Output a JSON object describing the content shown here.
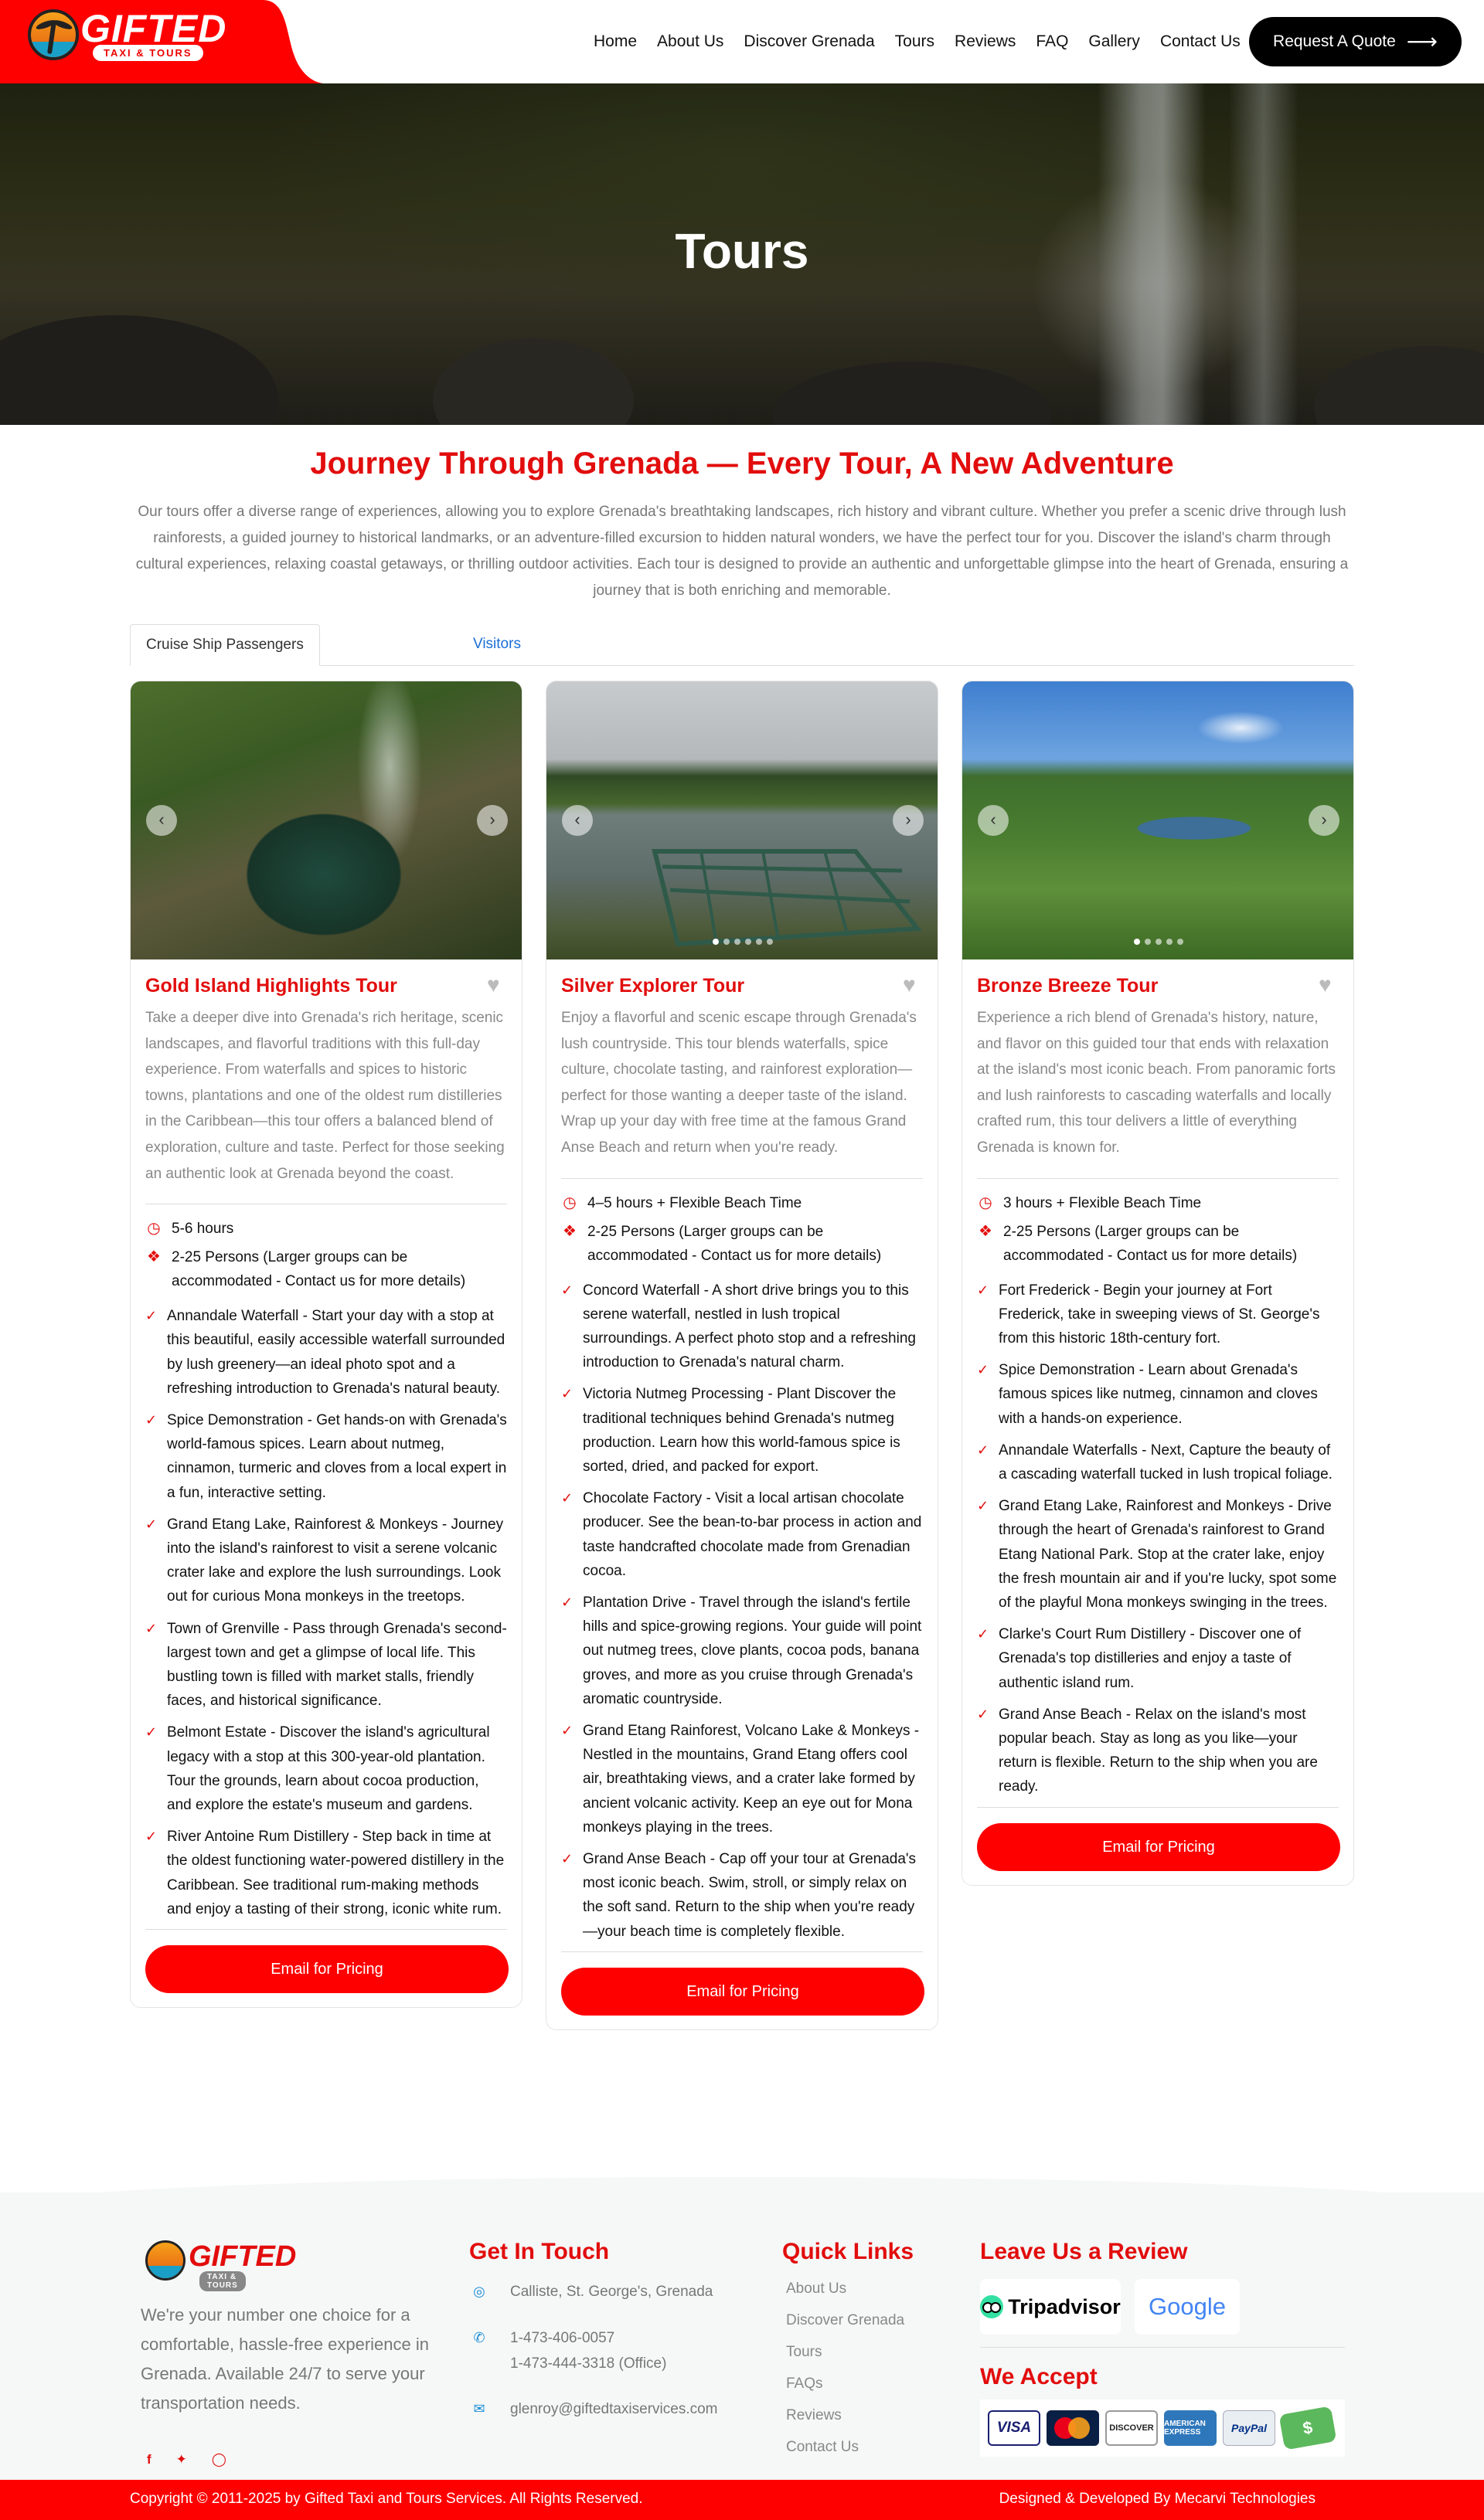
{
  "brand": {
    "name": "GIFTED",
    "tagline": "TAXI & TOURS"
  },
  "nav": [
    {
      "label": "Home"
    },
    {
      "label": "About Us"
    },
    {
      "label": "Discover Grenada"
    },
    {
      "label": "Tours"
    },
    {
      "label": "Reviews"
    },
    {
      "label": "FAQ"
    },
    {
      "label": "Gallery"
    },
    {
      "label": "Contact Us"
    }
  ],
  "cta": {
    "label": "Request A Quote",
    "icon": "arrow-right-icon"
  },
  "hero": {
    "title": "Tours"
  },
  "intro": {
    "title": "Journey Through Grenada — Every Tour, A New Adventure",
    "text": "Our tours offer a diverse range of experiences, allowing you to explore Grenada's breathtaking landscapes, rich history and vibrant culture. Whether you prefer a scenic drive through lush rainforests, a guided journey to historical landmarks, or an adventure-filled excursion to hidden natural wonders, we have the perfect tour for you. Discover the island's charm through cultural experiences, relaxing coastal getaways, or thrilling outdoor activities. Each tour is designed to provide an authentic and unforgettable glimpse into the heart of Grenada, ensuring a journey that is both enriching and memorable."
  },
  "tabs": [
    {
      "label": "Cruise Ship Passengers",
      "active": true
    },
    {
      "label": "Visitors",
      "active": false
    }
  ],
  "tours": [
    {
      "title": "Gold Island Highlights Tour",
      "description": "Take a deeper dive into Grenada's rich heritage, scenic landscapes, and flavorful traditions with this full-day experience. From waterfalls and spices to historic towns, plantations and one of the oldest rum distilleries in the Caribbean—this tour offers a balanced blend of exploration, culture and taste. Perfect for those seeking an authentic look at Grenada beyond the coast.",
      "duration": "5-6 hours",
      "group": "2-25 Persons (Larger groups can be accommodated - Contact us for more details)",
      "items": [
        "Annandale Waterfall - Start your day with a stop at this beautiful, easily accessible waterfall surrounded by lush greenery—an ideal photo spot and a refreshing introduction to Grenada's natural beauty.",
        "Spice Demonstration - Get hands-on with Grenada's world-famous spices. Learn about nutmeg, cinnamon, turmeric and cloves from a local expert in a fun, interactive setting.",
        "Grand Etang Lake, Rainforest & Monkeys - Journey into the island's rainforest to visit a serene volcanic crater lake and explore the lush surroundings. Look out for curious Mona monkeys in the treetops.",
        "Town of Grenville - Pass through Grenada's second-largest town and get a glimpse of local life. This bustling town is filled with market stalls, friendly faces, and historical significance.",
        "Belmont Estate - Discover the island's agricultural legacy with a stop at this 300-year-old plantation. Tour the grounds, learn about cocoa production, and explore the estate's museum and gardens.",
        "River Antoine Rum Distillery - Step back in time at the oldest functioning water-powered distillery in the Caribbean. See traditional rum-making methods and enjoy a tasting of their strong, iconic white rum."
      ],
      "button": "Email for Pricing"
    },
    {
      "title": "Silver Explorer Tour",
      "description": "Enjoy a flavorful and scenic escape through Grenada's lush countryside. This tour blends waterfalls, spice culture, chocolate tasting, and rainforest exploration—perfect for those wanting a deeper taste of the island. Wrap up your day with free time at the famous Grand Anse Beach and return when you're ready.",
      "duration": "4–5 hours + Flexible Beach Time",
      "group": "2-25 Persons (Larger groups can be accommodated - Contact us for more details)",
      "items": [
        "Concord Waterfall - A short drive brings you to this serene waterfall, nestled in lush tropical surroundings. A perfect photo stop and a refreshing introduction to Grenada's natural charm.",
        "Victoria Nutmeg Processing - Plant Discover the traditional techniques behind Grenada's nutmeg production. Learn how this world-famous spice is sorted, dried, and packed for export.",
        "Chocolate Factory - Visit a local artisan chocolate producer. See the bean-to-bar process in action and taste handcrafted chocolate made from Grenadian cocoa.",
        "Plantation Drive - Travel through the island's fertile hills and spice-growing regions. Your guide will point out nutmeg trees, clove plants, cocoa pods, banana groves, and more as you cruise through Grenada's aromatic countryside.",
        "Grand Etang Rainforest, Volcano Lake & Monkeys - Nestled in the mountains, Grand Etang offers cool air, breathtaking views, and a crater lake formed by ancient volcanic activity. Keep an eye out for Mona monkeys playing in the trees.",
        "Grand Anse Beach - Cap off your tour at Grenada's most iconic beach. Swim, stroll, or simply relax on the soft sand. Return to the ship when you're ready—your beach time is completely flexible."
      ],
      "button": "Email for Pricing"
    },
    {
      "title": "Bronze Breeze Tour",
      "description": "Experience a rich blend of Grenada's history, nature, and flavor on this guided tour that ends with relaxation at the island's most iconic beach. From panoramic forts and lush rainforests to cascading waterfalls and locally crafted rum, this tour delivers a little of everything Grenada is known for.",
      "duration": "3 hours + Flexible Beach Time",
      "group": "2-25 Persons (Larger groups can be accommodated - Contact us for more details)",
      "items": [
        "Fort Frederick - Begin your journey at Fort Frederick, take in sweeping views of St. George's from this historic 18th-century fort.",
        "Spice Demonstration - Learn about Grenada's famous spices like nutmeg, cinnamon and cloves with a hands-on experience.",
        "Annandale Waterfalls - Next, Capture the beauty of a cascading waterfall tucked in lush tropical foliage.",
        "Grand Etang Lake, Rainforest and Monkeys - Drive through the heart of Grenada's rainforest to Grand Etang National Park. Stop at the crater lake, enjoy the fresh mountain air and if you're lucky, spot some of the playful Mona monkeys swinging in the trees.",
        "Clarke's Court Rum Distillery - Discover one of Grenada's top distilleries and enjoy a taste of authentic island rum.",
        "Grand Anse Beach - Relax on the island's most popular beach. Stay as long as you like—your return is flexible. Return to the ship when you are ready."
      ],
      "button": "Email for Pricing"
    }
  ],
  "footer": {
    "about": "We're your number one choice for a comfortable, hassle-free experience in Grenada. Available 24/7 to serve your transportation needs.",
    "contact_title": "Get In Touch",
    "address": "Calliste, St. George's, Grenada",
    "phone1": "1-473-406-0057",
    "phone2": "1-473-444-3318 (Office)",
    "email": "glenroy@giftedtaxiservices.com",
    "links_title": "Quick Links",
    "links": [
      "About Us",
      "Discover Grenada",
      "Tours",
      "FAQs",
      "Reviews",
      "Contact Us"
    ],
    "review_title": "Leave Us a Review",
    "review_sites": [
      "Tripadvisor",
      "Google"
    ],
    "accept_title": "We Accept",
    "payments": [
      "VISA",
      "MasterCard",
      "DISCOVER",
      "AMERICAN EXPRESS",
      "PayPal",
      "$"
    ],
    "copyright": "Copyright © 2011-2025 by Gifted Taxi and Tours Services. All Rights Reserved.",
    "credit": "Designed & Developed By Mecarvi Technologies"
  },
  "colors": {
    "accent": "#ff0000",
    "title_red": "#e20d0d",
    "link_blue": "#1a6fd6"
  }
}
